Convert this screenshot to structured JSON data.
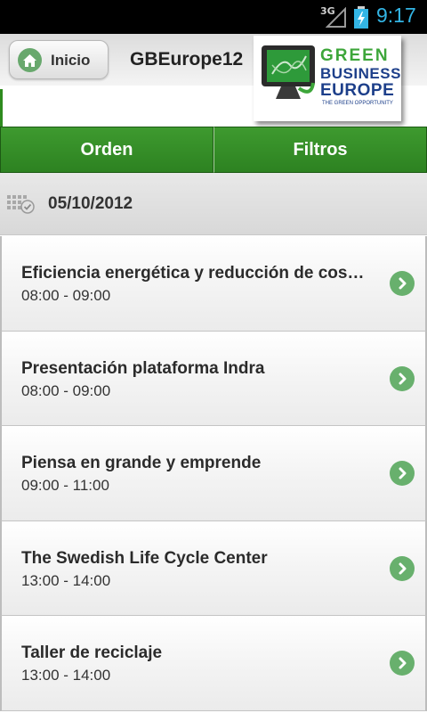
{
  "status_bar": {
    "network": "3G",
    "time": "9:17"
  },
  "header": {
    "back_label": "Inicio",
    "title": "GBEurope12",
    "logo": {
      "line1": "GREEN",
      "line2": "BUSINESS",
      "line3": "EUROPE",
      "tagline": "THE GREEN OPPORTUNITY"
    }
  },
  "tabs": [
    {
      "label": "Orden"
    },
    {
      "label": "Filtros"
    }
  ],
  "date_section": {
    "date": "05/10/2012"
  },
  "events": [
    {
      "title": "Eficiencia energética y reducción de cos…",
      "time": "08:00 - 09:00"
    },
    {
      "title": "Presentación plataforma Indra",
      "time": "08:00 - 09:00"
    },
    {
      "title": "Piensa en grande y emprende",
      "time": "09:00 - 11:00"
    },
    {
      "title": "The Swedish Life Cycle Center",
      "time": "13:00 - 14:00"
    },
    {
      "title": "Taller de reciclaje",
      "time": "13:00 - 14:00"
    }
  ],
  "colors": {
    "accent_green": "#3e9a2f",
    "chevron_green": "#68b06d",
    "status_time": "#33b5e5"
  },
  "icons": {
    "home": "home-icon",
    "calendar": "calendar-icon",
    "chevron": "chevron-right-icon"
  }
}
